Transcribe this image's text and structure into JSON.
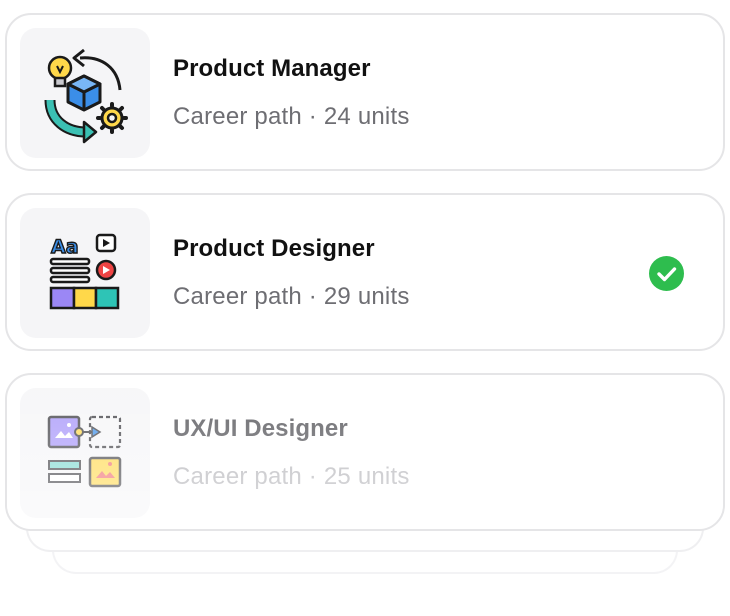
{
  "cards": [
    {
      "title": "Product Manager",
      "subtitle": "Career path · 24 units",
      "icon": "product-manager-icon",
      "completed": false
    },
    {
      "title": "Product Designer",
      "subtitle": "Career path · 29 units",
      "icon": "product-designer-icon",
      "completed": true
    },
    {
      "title": "UX/UI Designer",
      "subtitle": "Career path · 25 units",
      "icon": "ux-ui-designer-icon",
      "completed": false
    }
  ],
  "colors": {
    "check": "#2ebd4e",
    "card_border": "#e5e5e7",
    "thumb_bg": "#f5f5f7"
  }
}
